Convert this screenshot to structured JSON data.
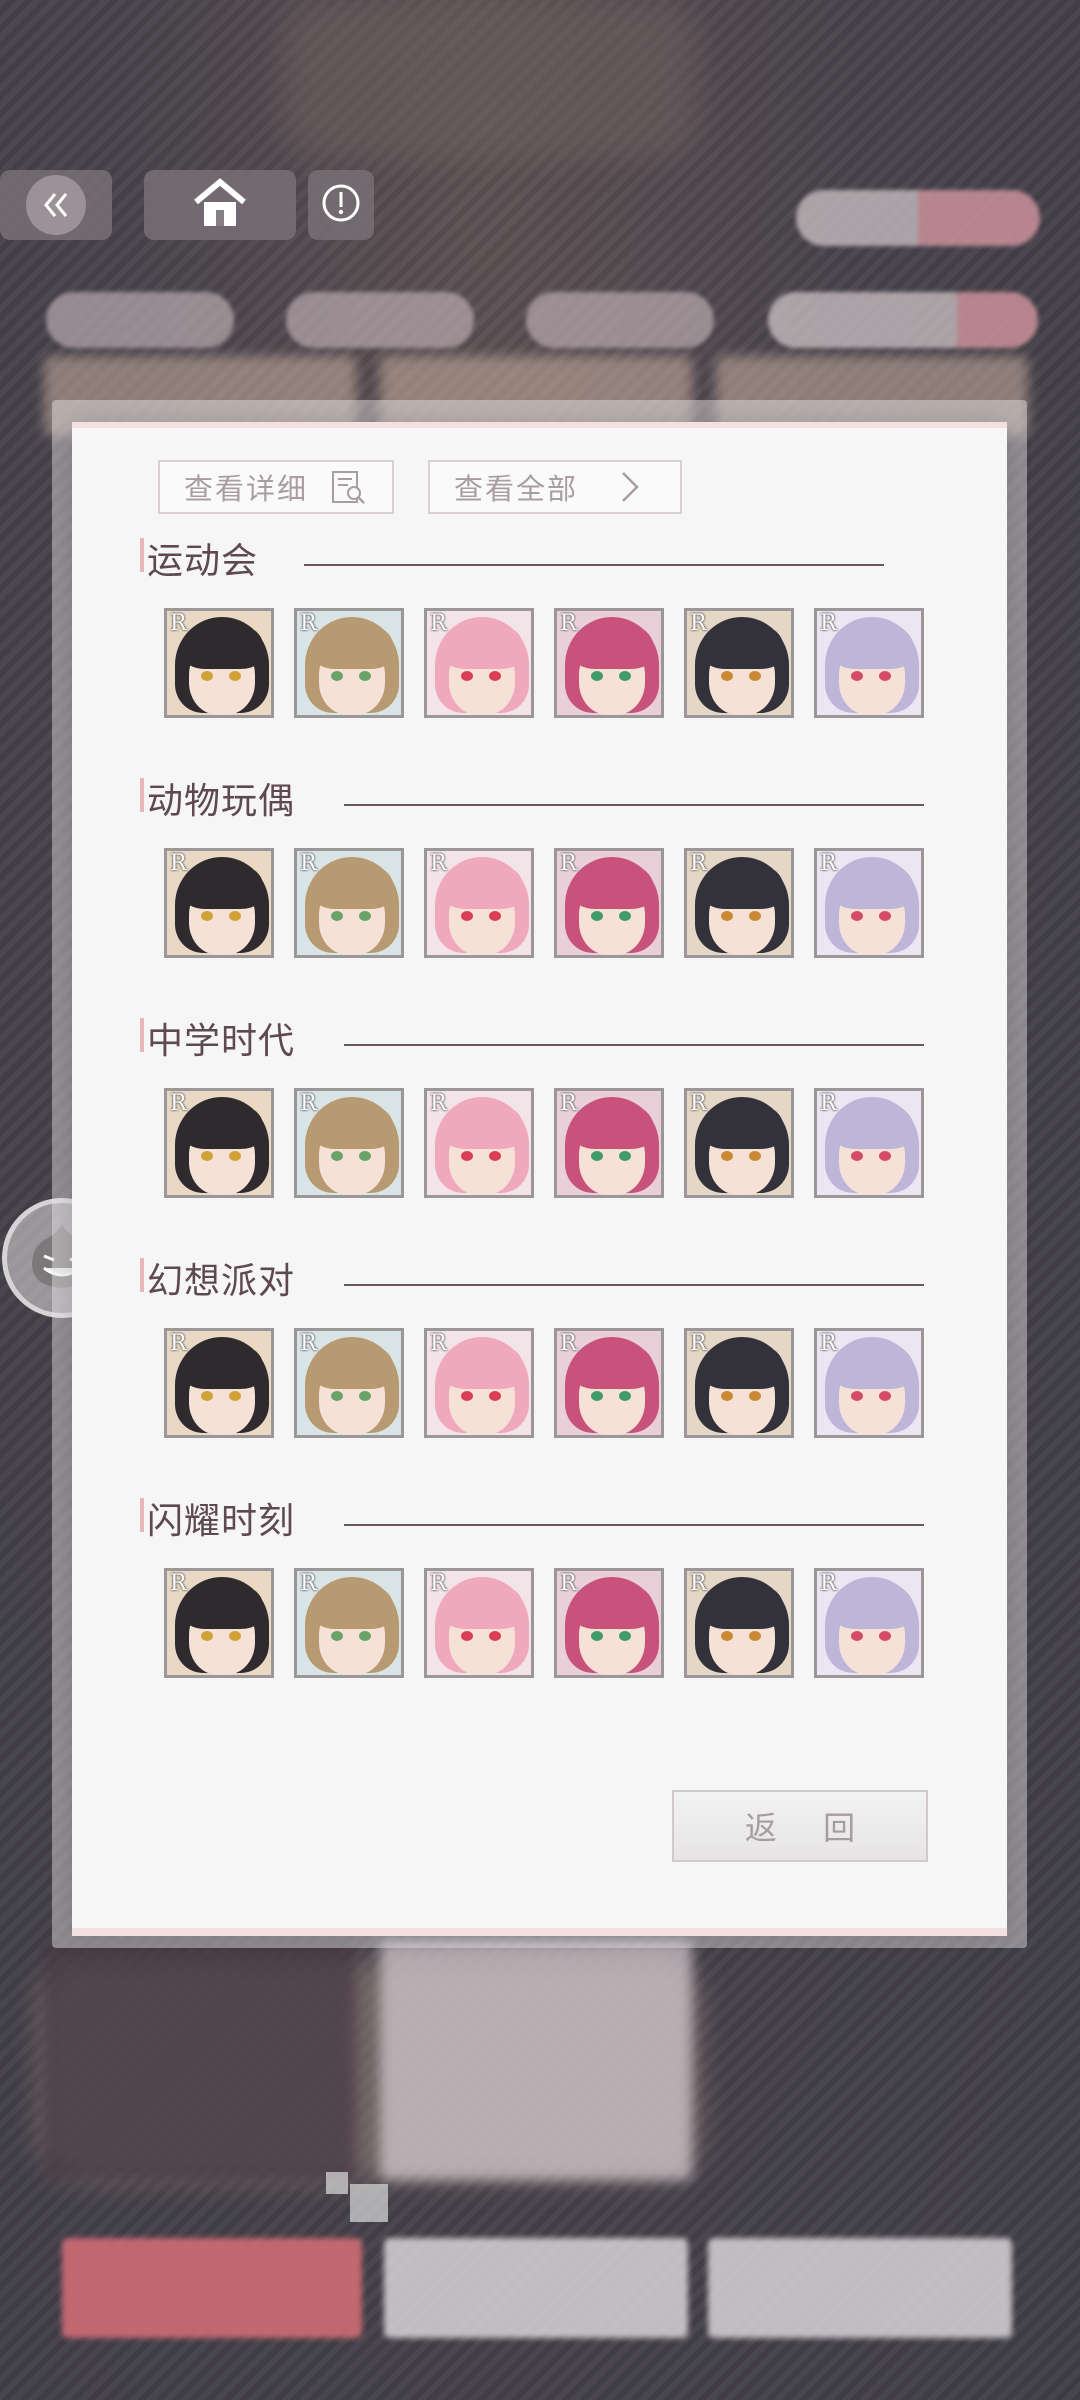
{
  "header": {
    "back_icon": "double-chevron-left-icon",
    "home_icon": "home-icon",
    "info_icon": "info-circle-icon"
  },
  "dialog": {
    "view_detail_label": "查看详细",
    "view_detail_icon": "document-search-icon",
    "view_all_label": "查看全部",
    "view_all_icon": "chevron-right-icon",
    "return_label": "返 回",
    "sections": [
      {
        "title": "运动会",
        "cards": [
          "R",
          "R",
          "R",
          "R",
          "R",
          "R"
        ]
      },
      {
        "title": "动物玩偶",
        "cards": [
          "R",
          "R",
          "R",
          "R",
          "R",
          "R"
        ]
      },
      {
        "title": "中学时代",
        "cards": [
          "R",
          "R",
          "R",
          "R",
          "R",
          "R"
        ]
      },
      {
        "title": "幻想派对",
        "cards": [
          "R",
          "R",
          "R",
          "R",
          "R",
          "R"
        ]
      },
      {
        "title": "闪耀时刻",
        "cards": [
          "R",
          "R",
          "R",
          "R",
          "R",
          "R"
        ]
      }
    ],
    "characters": [
      {
        "hair": "#2f2a2e",
        "eye": "#d2a23a",
        "bg": "#e8d8c4"
      },
      {
        "hair": "#b79a72",
        "eye": "#6aa36a",
        "bg": "#d9e4e7"
      },
      {
        "hair": "#f0a8bd",
        "eye": "#d83f57",
        "bg": "#f3e4ea"
      },
      {
        "hair": "#c9527c",
        "eye": "#3f9a6d",
        "bg": "#e9d0d8"
      },
      {
        "hair": "#33323a",
        "eye": "#c98a33",
        "bg": "#e4d7c6"
      },
      {
        "hair": "#bdb6d8",
        "eye": "#d64a6a",
        "bg": "#ebe6f2"
      }
    ]
  },
  "side": {
    "float_icon": "grinning-face-icon"
  }
}
